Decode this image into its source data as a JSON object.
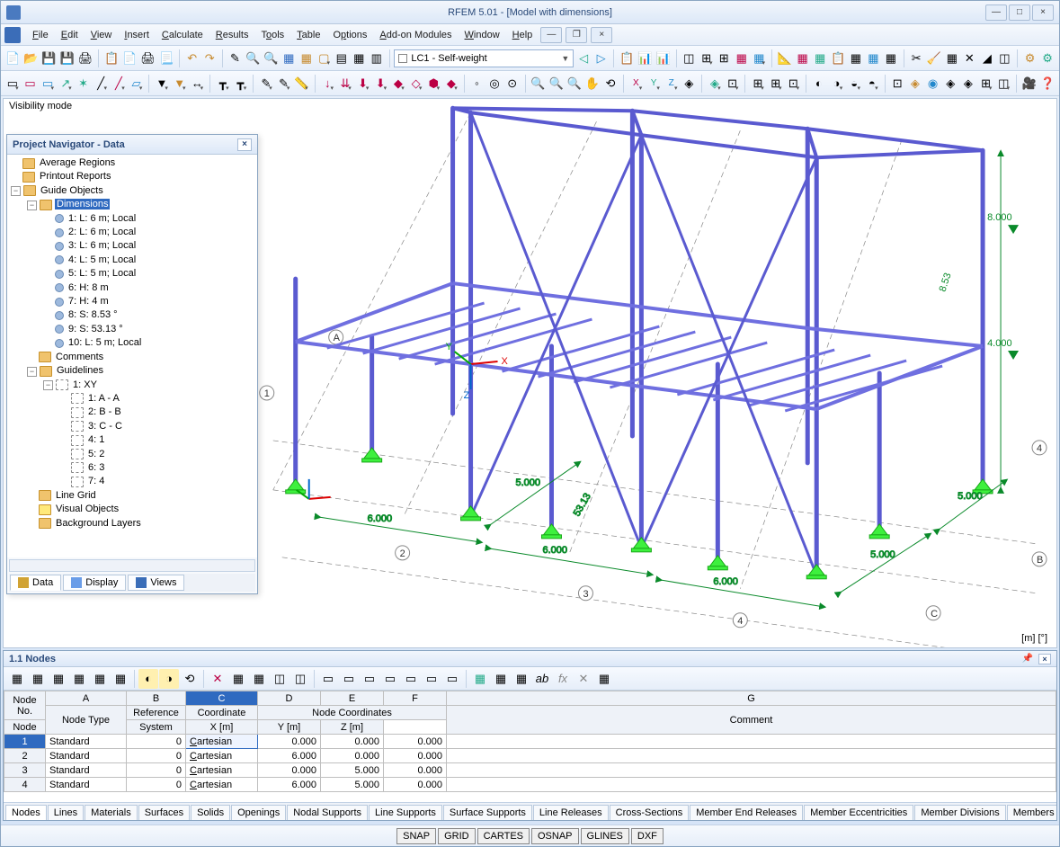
{
  "app": {
    "title_prefix": "RFEM 5.01",
    "title_suffix": "[Model with dimensions]"
  },
  "menus": [
    "File",
    "Edit",
    "View",
    "Insert",
    "Calculate",
    "Results",
    "Tools",
    "Table",
    "Options",
    "Add-on Modules",
    "Window",
    "Help"
  ],
  "loadcase_combo": "LC1 - Self-weight",
  "vismode": "Visibility mode",
  "navigator": {
    "title": "Project Navigator - Data",
    "tree": {
      "avg": "Average Regions",
      "print": "Printout Reports",
      "guide": "Guide Objects",
      "dim": "Dimensions",
      "dims": [
        "1: L: 6 m; Local",
        "2: L: 6 m; Local",
        "3: L: 6 m; Local",
        "4: L: 5 m; Local",
        "5: L: 5 m; Local",
        "6: H: 8 m",
        "7: H: 4 m",
        "8: S: 8.53 °",
        "9: S: 53.13 °",
        "10: L: 5 m; Local"
      ],
      "comments": "Comments",
      "guidelines": "Guidelines",
      "xy": "1: XY",
      "gls": [
        "1: A - A",
        "2: B - B",
        "3: C - C",
        "4: 1",
        "5: 2",
        "6: 3",
        "7: 4"
      ],
      "linegrid": "Line Grid",
      "visual": "Visual Objects",
      "bglayers": "Background Layers"
    },
    "tabs": {
      "data": "Data",
      "display": "Display",
      "views": "Views"
    }
  },
  "viewport": {
    "units": "[m] [°]",
    "dims": {
      "d6a": "6.000",
      "d6b": "6.000",
      "d6c": "6.000",
      "d5a": "5.000",
      "d5b": "5.000",
      "d5c": "5.000",
      "h8": "8.000",
      "h4": "4.000",
      "s53": "53.13",
      "s85": "8.53"
    },
    "gridlabels": [
      "A",
      "B",
      "C",
      "1",
      "2",
      "3",
      "4"
    ],
    "axis": [
      "X",
      "Y",
      "Z"
    ]
  },
  "bottom": {
    "title": "1.1 Nodes",
    "colletters": [
      "A",
      "B",
      "C",
      "D",
      "E",
      "F",
      "G"
    ],
    "headers": {
      "no": "Node\nNo.",
      "type": "Node Type",
      "ref": "Reference\nNode",
      "cs": "Coordinate\nSystem",
      "coords": "Node Coordinates",
      "x": "X [m]",
      "y": "Y [m]",
      "z": "Z [m]",
      "comment": "Comment"
    },
    "rows": [
      {
        "no": "1",
        "type": "Standard",
        "ref": "0",
        "cs": "Cartesian",
        "x": "0.000",
        "y": "0.000",
        "z": "0.000"
      },
      {
        "no": "2",
        "type": "Standard",
        "ref": "0",
        "cs": "Cartesian",
        "x": "6.000",
        "y": "0.000",
        "z": "0.000"
      },
      {
        "no": "3",
        "type": "Standard",
        "ref": "0",
        "cs": "Cartesian",
        "x": "0.000",
        "y": "5.000",
        "z": "0.000"
      },
      {
        "no": "4",
        "type": "Standard",
        "ref": "0",
        "cs": "Cartesian",
        "x": "6.000",
        "y": "5.000",
        "z": "0.000"
      }
    ],
    "tabs": [
      "Nodes",
      "Lines",
      "Materials",
      "Surfaces",
      "Solids",
      "Openings",
      "Nodal Supports",
      "Line Supports",
      "Surface Supports",
      "Line Releases",
      "Cross-Sections",
      "Member End Releases",
      "Member Eccentricities",
      "Member Divisions",
      "Members"
    ]
  },
  "status": [
    "SNAP",
    "GRID",
    "CARTES",
    "OSNAP",
    "GLINES",
    "DXF"
  ]
}
